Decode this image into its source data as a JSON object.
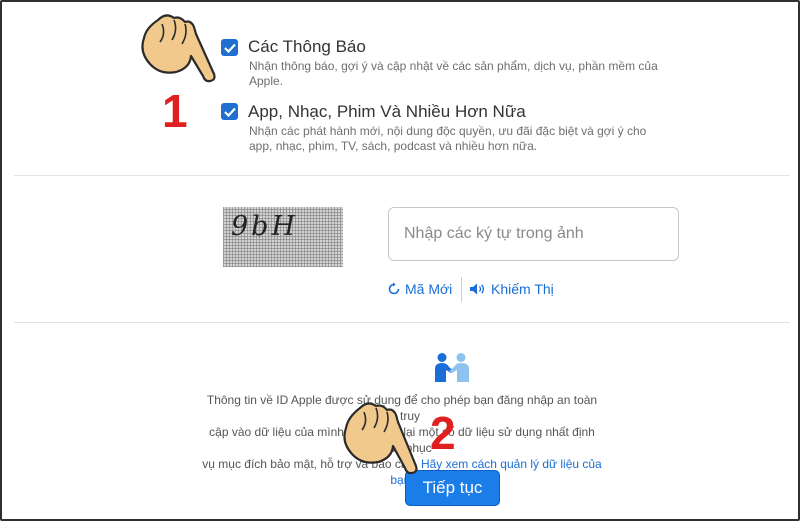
{
  "options": [
    {
      "checked": true,
      "title": "Các Thông Báo",
      "desc_line1": "Nhận thông báo, gợi ý và cập nhật về các sản phẩm, dịch vụ, phần mềm của",
      "desc_line2": "Apple."
    },
    {
      "checked": true,
      "title": "App, Nhạc, Phim Và Nhiều Hơn Nữa",
      "desc_line1": "Nhận các phát hành mới, nội dung độc quyền, ưu đãi đặc biệt và gợi ý cho",
      "desc_line2": "app, nhạc, phim, TV, sách, podcast và nhiều hơn nữa."
    }
  ],
  "captcha": {
    "image_text": "9bH",
    "input_placeholder": "Nhập các ký tự trong ảnh",
    "input_value": "",
    "new_code_label": "Mã Mới",
    "vision_impaired_label": "Khiếm Thị"
  },
  "privacy": {
    "line1": "Thông tin về ID Apple được sử dụng để cho phép bạn đăng nhập an toàn và truy",
    "line2": "cập vào dữ liệu của mình. Apple ghi lại một số dữ liệu sử dụng nhất định nhằm phục",
    "line3_prefix": "vụ mục đích bảo mật, hỗ trợ và báo cáo.",
    "link_text": "Hãy xem cách quản lý dữ liệu của bạn."
  },
  "continue_button": "Tiếp tục",
  "annotations": {
    "step1": "1",
    "step2": "2"
  },
  "colors": {
    "accent": "#1a7de8",
    "link": "#1a6ed8",
    "step_marker": "#e02020",
    "hand": "#f2c98c"
  },
  "icons": [
    "checkbox-check-icon",
    "refresh-icon",
    "speaker-icon",
    "handshake-icon",
    "pointing-hand-icon"
  ]
}
